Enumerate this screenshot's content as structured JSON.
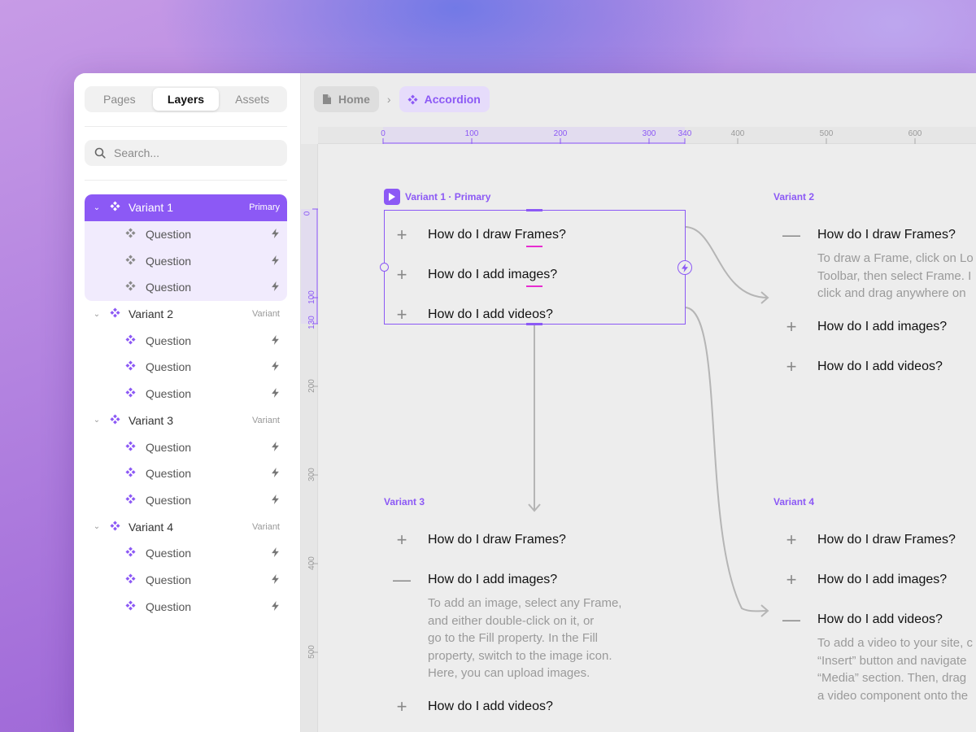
{
  "sidebar": {
    "tabs": [
      "Pages",
      "Layers",
      "Assets"
    ],
    "active_tab": "Layers",
    "search_placeholder": "Search...",
    "variants": [
      {
        "label": "Variant 1",
        "badge": "Primary",
        "selected": true,
        "children": [
          "Question",
          "Question",
          "Question"
        ]
      },
      {
        "label": "Variant 2",
        "badge": "Variant",
        "selected": false,
        "children": [
          "Question",
          "Question",
          "Question"
        ]
      },
      {
        "label": "Variant 3",
        "badge": "Variant",
        "selected": false,
        "children": [
          "Question",
          "Question",
          "Question"
        ]
      },
      {
        "label": "Variant 4",
        "badge": "Variant",
        "selected": false,
        "children": [
          "Question",
          "Question",
          "Question"
        ]
      }
    ]
  },
  "breadcrumb": {
    "home": "Home",
    "separator": "›",
    "current": "Accordion"
  },
  "rulers": {
    "top": [
      "0",
      "100",
      "200",
      "300",
      "340",
      "400",
      "500",
      "600"
    ],
    "left": [
      "0",
      "100",
      "130",
      "200",
      "300",
      "400",
      "500"
    ]
  },
  "canvas": {
    "variant1": {
      "label": "Variant 1 · Primary",
      "items": [
        {
          "symbol": "+",
          "text": "How do I draw Frames?"
        },
        {
          "symbol": "+",
          "text": "How do I add images?"
        },
        {
          "symbol": "+",
          "text": "How do I add videos?"
        }
      ]
    },
    "variant2": {
      "label": "Variant 2",
      "items": [
        {
          "symbol": "—",
          "text": "How do I draw Frames?"
        },
        {
          "symbol": "+",
          "text": "How do I add images?"
        },
        {
          "symbol": "+",
          "text": "How do I add videos?"
        }
      ],
      "body": [
        "To draw a Frame, click on Lo",
        "Toolbar, then select Frame. I",
        "click and drag anywhere on"
      ]
    },
    "variant3": {
      "label": "Variant 3",
      "items": [
        {
          "symbol": "+",
          "text": "How do I draw Frames?"
        },
        {
          "symbol": "—",
          "text": "How do I add images?"
        },
        {
          "symbol": "+",
          "text": "How do I add videos?"
        }
      ],
      "body": [
        "To add an image, select any Frame,",
        "and either double-click on it, or",
        "go to the Fill property. In the Fill",
        "property, switch to the image icon.",
        "Here, you can upload images."
      ]
    },
    "variant4": {
      "label": "Variant 4",
      "items": [
        {
          "symbol": "+",
          "text": "How do I draw Frames?"
        },
        {
          "symbol": "+",
          "text": "How do I add images?"
        },
        {
          "symbol": "—",
          "text": "How do I add videos?"
        }
      ],
      "body": [
        "To add a video to your site, c",
        "“Insert” button and navigate",
        "“Media” section. Then, drag",
        "a video component onto the"
      ]
    }
  },
  "colors": {
    "accent": "#8c59f5",
    "accent_light": "#f1ebfd",
    "pink_guides": "#e72cd0",
    "text_dark": "#111111",
    "text_muted": "#9a9a9a"
  },
  "icons": {
    "search": "search-icon",
    "component": "component-icon",
    "bolt": "bolt-icon",
    "chevron": "chevron-down-icon",
    "page": "page-icon",
    "play": "play-icon"
  }
}
